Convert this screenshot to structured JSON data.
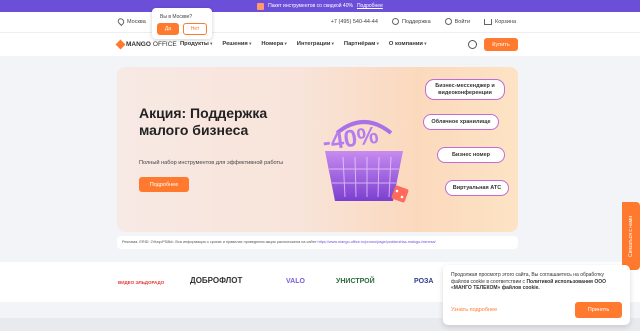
{
  "promo": {
    "text": "Пакет инструментов со скидкой 40%",
    "link": "Подробнее"
  },
  "topbar": {
    "city": "Москва",
    "phone": "+7 (495) 540-44-44",
    "support": "Поддержка",
    "login": "Войти",
    "cart": "Корзина"
  },
  "city_popup": {
    "question": "Вы в Москве?",
    "yes": "Да",
    "no": "Нет"
  },
  "logo": {
    "brand": "MANGO",
    "office": "OFFICE"
  },
  "nav": {
    "items": [
      "Продукты",
      "Решения",
      "Номера",
      "Интеграции",
      "Партнёрам",
      "О компании"
    ],
    "buy": "Купить"
  },
  "hero": {
    "title": "Акция: Поддержка малого бизнеса",
    "subtitle": "Полный набор инструментов для эффективной работы",
    "button": "Подробнее",
    "discount": "-40%",
    "features": [
      "Бизнес-мессенджер и видеоконференции",
      "Облачное хранилище",
      "Бизнес номер",
      "Виртуальная АТС"
    ]
  },
  "legal": {
    "text": "Реклама. ERID: 2VtzqvPS8kh. Вся информация о сроках и правилах проведения акции расположена на сайте",
    "url": "https://www.mango-office.ru/promo/page/podderzhka-malogo-biznesa/"
  },
  "partners": [
    "ВИДЕО ЭЛЬДОРАДО",
    "ДОБРОФЛОТ",
    "VALO",
    "УНИСТРОЙ",
    "РОЗА"
  ],
  "cookie": {
    "text": "Продолжая просмотр этого сайта, Вы соглашаетесь на обработку файлов cookie в соответствии с",
    "policy": "Политикой использования ООО «МАНГО ТЕЛЕКОМ» файлов cookie.",
    "more": "Узнать подробнее",
    "accept": "Принять"
  },
  "side_tab": "Связаться с нами",
  "colors": {
    "accent": "#ff7a2f",
    "purple": "#6b4fd8"
  }
}
